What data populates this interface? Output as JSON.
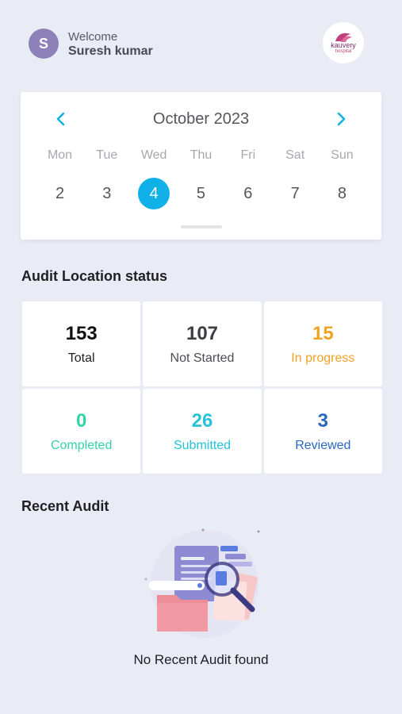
{
  "header": {
    "avatar_initial": "S",
    "welcome": "Welcome",
    "username": "Suresh kumar",
    "logo_text": "kauvery",
    "logo_subtext": "hospital"
  },
  "calendar": {
    "month_label": "October 2023",
    "weekdays": [
      "Mon",
      "Tue",
      "Wed",
      "Thu",
      "Fri",
      "Sat",
      "Sun"
    ],
    "days": [
      "2",
      "3",
      "4",
      "5",
      "6",
      "7",
      "8"
    ],
    "selected_index": 2,
    "accent_color": "#10b0e8"
  },
  "audit_status": {
    "title": "Audit Location status",
    "cards": [
      {
        "value": "153",
        "label": "Total",
        "color": "#111114"
      },
      {
        "value": "107",
        "label": "Not Started",
        "color": "#3c3c42"
      },
      {
        "value": "15",
        "label": "In progress",
        "color": "#f0a323"
      },
      {
        "value": "0",
        "label": "Completed",
        "color": "#33d3a6"
      },
      {
        "value": "26",
        "label": "Submitted",
        "color": "#26c3d8"
      },
      {
        "value": "3",
        "label": "Reviewed",
        "color": "#2a66c2"
      }
    ]
  },
  "recent_audit": {
    "title": "Recent Audit",
    "empty_text": "No Recent Audit found",
    "empty_icon": "documents-search-illustration"
  }
}
